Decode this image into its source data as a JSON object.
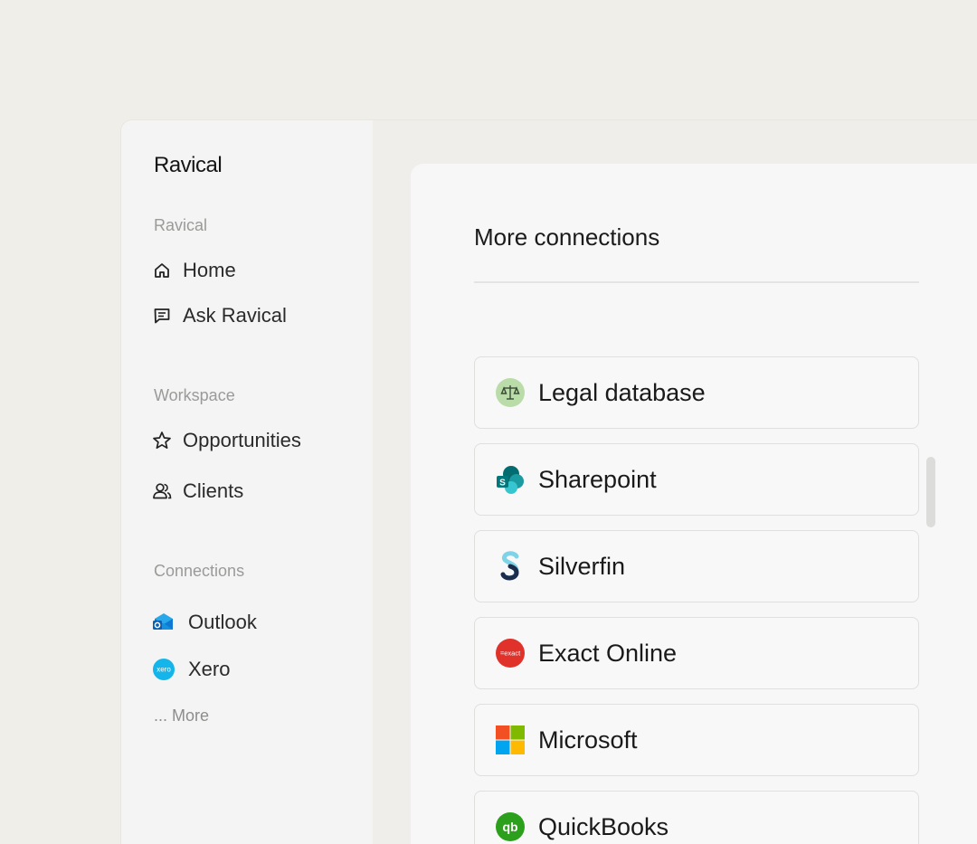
{
  "app": {
    "logo": "Ravical"
  },
  "sidebar": {
    "sections": [
      {
        "label": "Ravical"
      },
      {
        "label": "Workspace"
      },
      {
        "label": "Connections"
      }
    ],
    "ravical_items": [
      {
        "label": "Home",
        "icon": "home-icon"
      },
      {
        "label": "Ask Ravical",
        "icon": "chat-icon"
      }
    ],
    "workspace_items": [
      {
        "label": "Opportunities",
        "icon": "star-icon"
      },
      {
        "label": "Clients",
        "icon": "users-icon"
      }
    ],
    "connection_items": [
      {
        "label": "Outlook",
        "icon": "outlook-icon"
      },
      {
        "label": "Xero",
        "icon": "xero-icon"
      }
    ],
    "more_label": "... More"
  },
  "panel": {
    "title": "More connections",
    "connections": [
      {
        "label": "Legal database",
        "icon": "scales-icon"
      },
      {
        "label": "Sharepoint",
        "icon": "sharepoint-icon"
      },
      {
        "label": "Silverfin",
        "icon": "silverfin-icon"
      },
      {
        "label": "Exact Online",
        "icon": "exact-icon",
        "icon_text": "=exact"
      },
      {
        "label": "Microsoft",
        "icon": "microsoft-icon"
      },
      {
        "label": "QuickBooks",
        "icon": "quickbooks-icon",
        "icon_text": "qb"
      }
    ]
  },
  "colors": {
    "outlook_blue": "#0f78d4",
    "xero_blue": "#13b5ea",
    "exact_red": "#e0312b",
    "quickbooks_green": "#2ca01c",
    "legal_green": "#b9dca8"
  }
}
